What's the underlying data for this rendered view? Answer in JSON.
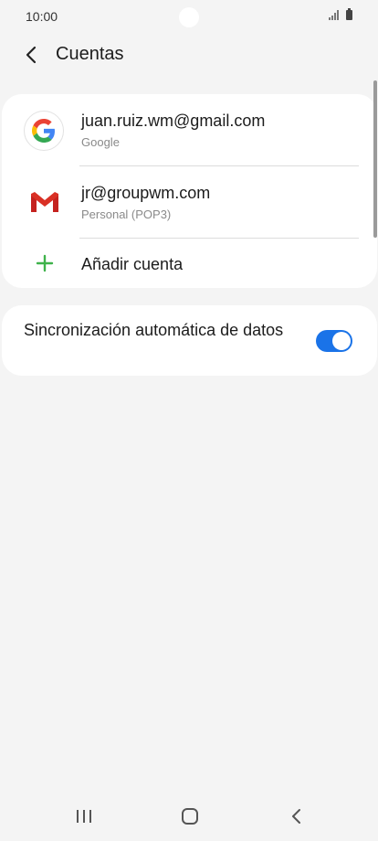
{
  "status_bar": {
    "time": "10:00"
  },
  "header": {
    "title": "Cuentas"
  },
  "accounts": [
    {
      "email": "juan.ruiz.wm@gmail.com",
      "type": "Google",
      "icon": "google-icon"
    },
    {
      "email": "jr@groupwm.com",
      "type": "Personal (POP3)",
      "icon": "gmail-icon"
    }
  ],
  "add_account": {
    "label": "Añadir cuenta"
  },
  "sync": {
    "label": "Sincronización automática de datos",
    "enabled": true
  },
  "colors": {
    "accent": "#1a73e8",
    "add_plus": "#3fb24b",
    "gmail_red": "#d93025"
  }
}
